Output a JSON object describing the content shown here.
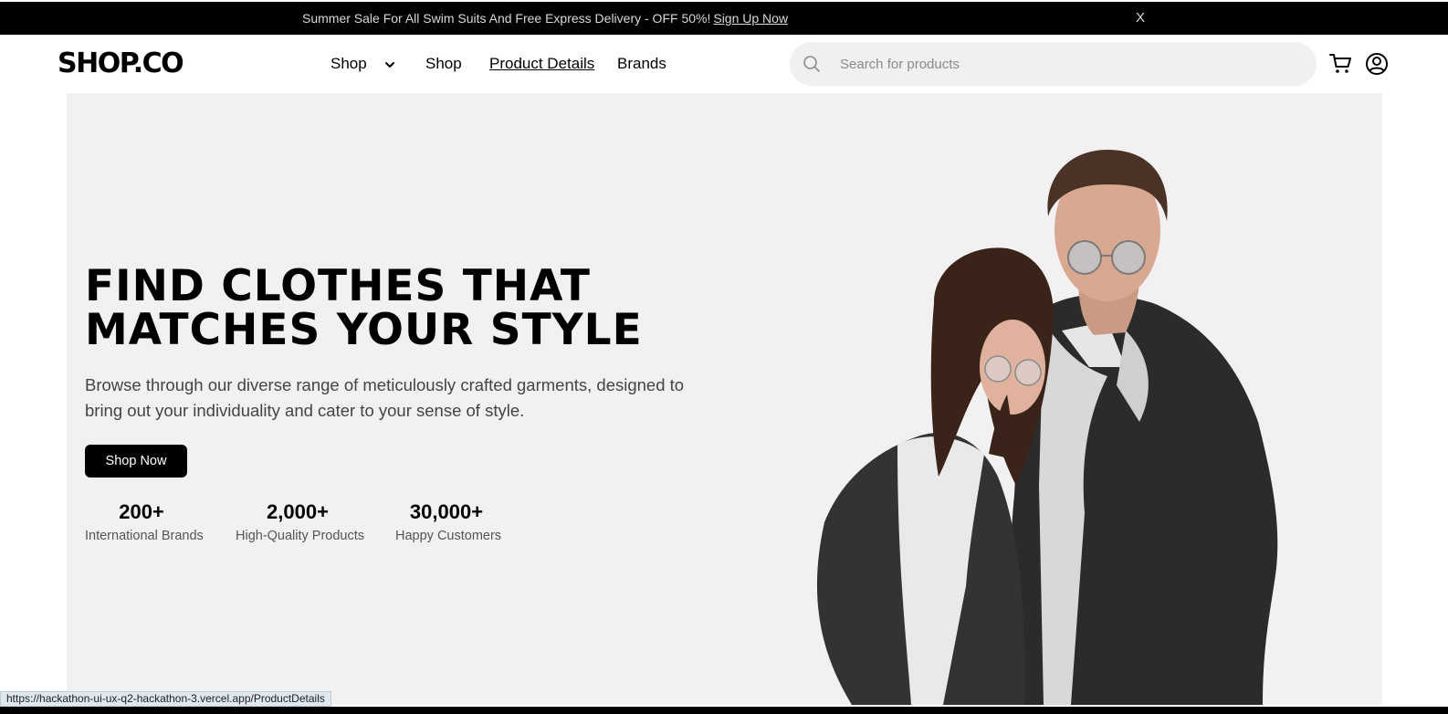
{
  "announcement": {
    "text": "Summer Sale For All Swim Suits And Free Express Delivery - OFF 50%!",
    "link_label": "Sign Up Now",
    "close_label": "X"
  },
  "header": {
    "logo": "SHOP.CO",
    "nav": [
      {
        "label": "Shop",
        "icon": "chevron-down-icon"
      },
      {
        "label": "Shop"
      },
      {
        "label": "Product Details",
        "active": true
      },
      {
        "label": "Brands"
      }
    ],
    "search": {
      "placeholder": "Search for products",
      "value": "",
      "icon": "search-icon"
    },
    "icons": [
      "cart-icon",
      "user-account-icon"
    ]
  },
  "hero": {
    "title_line1": "FIND CLOTHES THAT",
    "title_line2": "MATCHES YOUR STYLE",
    "description": "Browse through our diverse range of meticulously crafted garments, designed to bring out your individuality and cater to your sense of style.",
    "cta_label": "Shop Now",
    "stats": [
      {
        "value": "200+",
        "label": "International Brands"
      },
      {
        "value": "2,000+",
        "label": "High-Quality Products"
      },
      {
        "value": "30,000+",
        "label": "Happy Customers"
      }
    ],
    "image_alt": "couple wearing denim jackets and hoodies"
  },
  "status_bar": {
    "url": "https://hackathon-ui-ux-q2-hackathon-3.vercel.app/ProductDetails"
  },
  "colors": {
    "announcement_bg": "#000000",
    "hero_bg": "#f2f0f1",
    "button_bg": "#000000",
    "search_bg": "#f0f0f0"
  }
}
